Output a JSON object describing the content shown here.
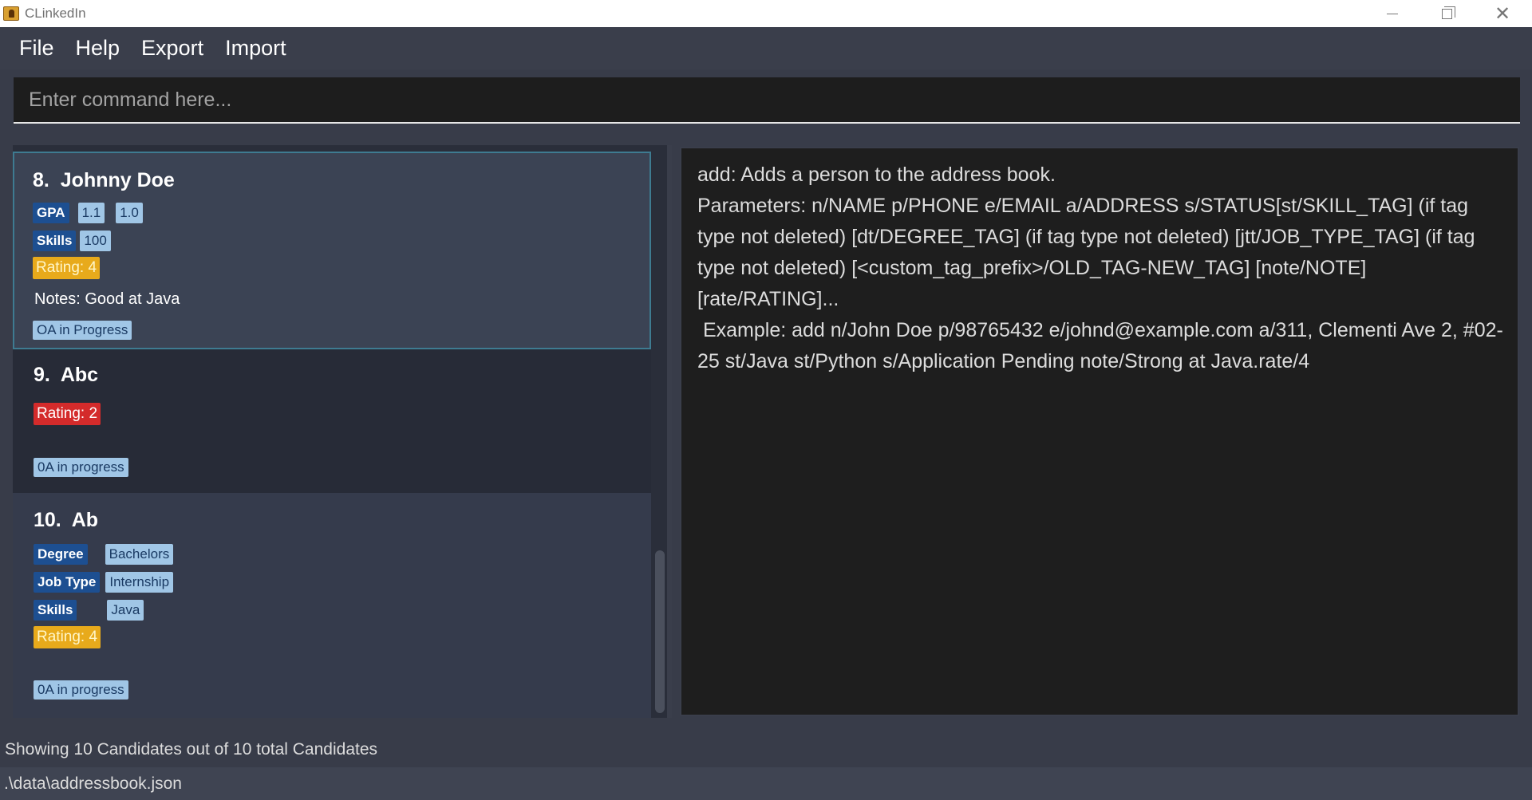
{
  "window": {
    "title": "CLinkedIn",
    "minimize_icon": "minimize-icon",
    "maximize_icon": "restore-icon",
    "close_icon": "close-icon"
  },
  "menu": {
    "items": [
      "File",
      "Help",
      "Export",
      "Import"
    ]
  },
  "command": {
    "placeholder": "Enter command here..."
  },
  "candidates": [
    {
      "index": "8.",
      "name": "Johnny Doe",
      "tag_rows": [
        {
          "key": "GPA",
          "values": [
            "1.1",
            "1.0"
          ]
        },
        {
          "key": "Skills",
          "values": [
            "100"
          ]
        }
      ],
      "rating": "Rating: 4",
      "rating_color": "#e8aa1b",
      "notes": "Notes: Good at Java",
      "status": "OA in Progress",
      "selected": true
    },
    {
      "index": "9.",
      "name": "Abc",
      "tag_rows": [],
      "rating": "Rating: 2",
      "rating_color": "#d42b2b",
      "notes": "",
      "status": "0A in progress",
      "selected": false
    },
    {
      "index": "10.",
      "name": "Ab",
      "tag_rows": [
        {
          "key": "Degree",
          "values": [
            "Bachelors"
          ]
        },
        {
          "key": "Job Type",
          "values": [
            "Internship"
          ]
        },
        {
          "key": "Skills",
          "values": [
            "Java"
          ]
        }
      ],
      "rating": "Rating: 4",
      "rating_color": "#e8aa1b",
      "notes": "",
      "status": "0A in progress",
      "selected": false
    }
  ],
  "result": {
    "text": "add: Adds a person to the address book.\nParameters: n/NAME p/PHONE e/EMAIL a/ADDRESS s/STATUS[st/SKILL_TAG] (if tag type not deleted) [dt/DEGREE_TAG] (if tag type not deleted) [jtt/JOB_TYPE_TAG] (if tag type not deleted) [<custom_tag_prefix>/OLD_TAG-NEW_TAG] [note/NOTE] [rate/RATING]...\n Example: add n/John Doe p/98765432 e/johnd@example.com a/311, Clementi Ave 2, #02-25 st/Java st/Python s/Application Pending note/Strong at Java.rate/4"
  },
  "status_bar": {
    "prefix": "Showing ",
    "shown": "10",
    "middle": " Candidates out of ",
    "total": "10",
    "suffix": " total Candidates"
  },
  "file_path": ".\\data\\addressbook.json",
  "colors": {
    "background": "#383c49",
    "selected_border": "#3e7b91",
    "tag_key": "#1d4f91",
    "tag_value": "#a0c6e6"
  }
}
